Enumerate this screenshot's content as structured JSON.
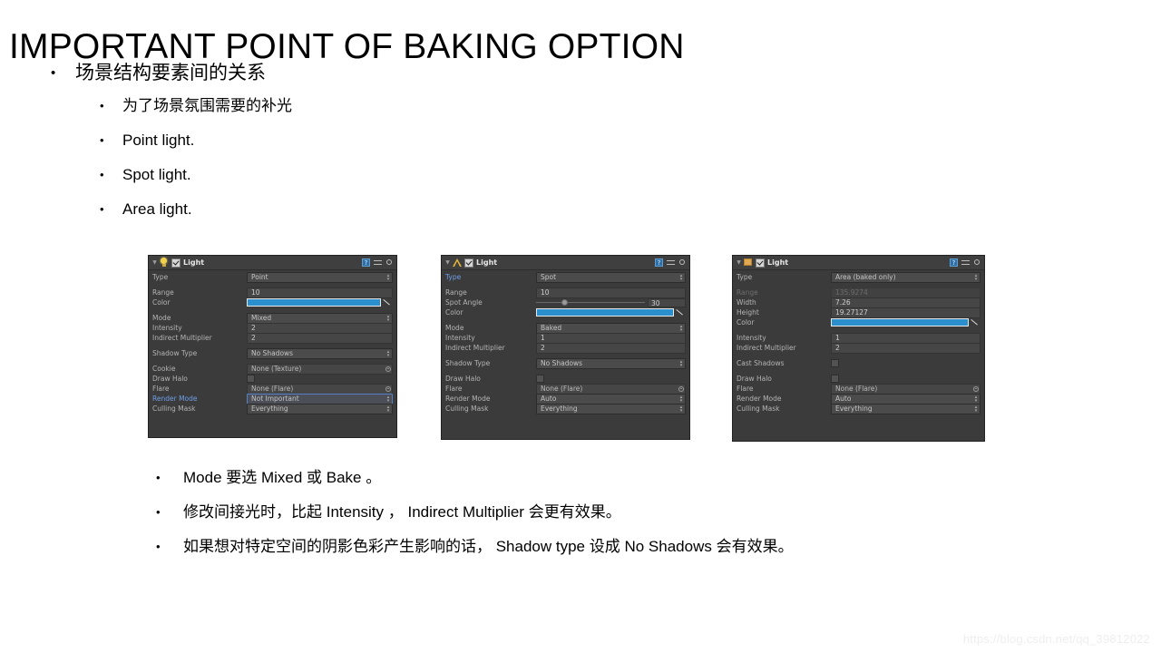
{
  "slide": {
    "title": "IMPORTANT POINT OF BAKING OPTION",
    "bullet_char": "•",
    "watermark": "https://blog.csdn.net/qq_39812022"
  },
  "top_bullets": [
    {
      "level": 1,
      "text": "场景结构要素间的关系"
    },
    {
      "level": 2,
      "text": "为了场景氛围需要的补光"
    },
    {
      "level": 2,
      "text": "Point light."
    },
    {
      "level": 2,
      "text": "Spot light."
    },
    {
      "level": 2,
      "text": "Area light."
    }
  ],
  "bottom_bullets": [
    {
      "text": "Mode 要选 Mixed 或 Bake 。"
    },
    {
      "text": "修改间接光时，比起 Intensity ，  Indirect Multiplier 会更有效果。"
    },
    {
      "text": "如果想对特定空间的阴影色彩产生影响的话，  Shadow type 设成 No Shadows 会有效果。"
    }
  ],
  "colors": {
    "light_color_swatch": "#2b8fce",
    "panel_background": "#3b3b3b",
    "highlight_label": "#6f9fe8",
    "bulb_icon": "#f2d24a",
    "cone_icon": "#e2b43c",
    "area_icon": "#e0a850"
  },
  "inspectors": [
    {
      "component_name": "Light",
      "icon": "point-light-bulb-icon",
      "enabled": true,
      "label_width": 104,
      "header_icons": [
        "help-icon",
        "preset-icon",
        "gear-icon"
      ],
      "rows": [
        {
          "kind": "popup",
          "label": "Type",
          "value": "Point"
        },
        {
          "kind": "spacer"
        },
        {
          "kind": "number",
          "label": "Range",
          "value": "10"
        },
        {
          "kind": "color",
          "label": "Color",
          "value": "#2b8fce"
        },
        {
          "kind": "spacer"
        },
        {
          "kind": "popup",
          "label": "Mode",
          "value": "Mixed"
        },
        {
          "kind": "number",
          "label": "Intensity",
          "value": "2"
        },
        {
          "kind": "number",
          "label": "Indirect Multiplier",
          "value": "2"
        },
        {
          "kind": "spacer"
        },
        {
          "kind": "popup",
          "label": "Shadow Type",
          "value": "No Shadows"
        },
        {
          "kind": "spacer"
        },
        {
          "kind": "object",
          "label": "Cookie",
          "value": "None (Texture)"
        },
        {
          "kind": "check",
          "label": "Draw Halo",
          "value": ""
        },
        {
          "kind": "object",
          "label": "Flare",
          "value": "None (Flare)"
        },
        {
          "kind": "popup",
          "label": "Render Mode",
          "value": "Not Important",
          "highlight": true
        },
        {
          "kind": "popup",
          "label": "Culling Mask",
          "value": "Everything"
        }
      ]
    },
    {
      "component_name": "Light",
      "icon": "spot-light-cone-icon",
      "enabled": true,
      "label_width": 100,
      "header_icons": [
        "help-icon",
        "preset-icon",
        "gear-icon"
      ],
      "rows": [
        {
          "kind": "popup",
          "label": "Type",
          "value": "Spot",
          "label_highlight": true
        },
        {
          "kind": "spacer"
        },
        {
          "kind": "number",
          "label": "Range",
          "value": "10"
        },
        {
          "kind": "slider",
          "label": "Spot Angle",
          "value": "30"
        },
        {
          "kind": "color",
          "label": "Color",
          "value": "#2b8fce"
        },
        {
          "kind": "spacer"
        },
        {
          "kind": "popup",
          "label": "Mode",
          "value": "Baked"
        },
        {
          "kind": "number",
          "label": "Intensity",
          "value": "1"
        },
        {
          "kind": "number",
          "label": "Indirect Multiplier",
          "value": "2"
        },
        {
          "kind": "spacer"
        },
        {
          "kind": "popup",
          "label": "Shadow Type",
          "value": "No Shadows"
        },
        {
          "kind": "spacer"
        },
        {
          "kind": "check",
          "label": "Draw Halo",
          "value": ""
        },
        {
          "kind": "object",
          "label": "Flare",
          "value": "None (Flare)"
        },
        {
          "kind": "popup",
          "label": "Render Mode",
          "value": "Auto"
        },
        {
          "kind": "popup",
          "label": "Culling Mask",
          "value": "Everything"
        }
      ]
    },
    {
      "component_name": "Light",
      "icon": "area-light-square-icon",
      "enabled": true,
      "label_width": 104,
      "header_icons": [
        "help-icon",
        "preset-icon",
        "gear-icon"
      ],
      "rows": [
        {
          "kind": "popup",
          "label": "Type",
          "value": "Area (baked only)"
        },
        {
          "kind": "spacer"
        },
        {
          "kind": "number",
          "label": "Range",
          "value": "135.9274",
          "disabled": true
        },
        {
          "kind": "number",
          "label": "Width",
          "value": "7.26"
        },
        {
          "kind": "number",
          "label": "Height",
          "value": "19.27127"
        },
        {
          "kind": "color",
          "label": "Color",
          "value": "#2b8fce"
        },
        {
          "kind": "spacer"
        },
        {
          "kind": "number",
          "label": "Intensity",
          "value": "1"
        },
        {
          "kind": "number",
          "label": "Indirect Multiplier",
          "value": "2"
        },
        {
          "kind": "spacer"
        },
        {
          "kind": "check",
          "label": "Cast Shadows",
          "value": ""
        },
        {
          "kind": "spacer"
        },
        {
          "kind": "check",
          "label": "Draw Halo",
          "value": ""
        },
        {
          "kind": "object",
          "label": "Flare",
          "value": "None (Flare)"
        },
        {
          "kind": "popup",
          "label": "Render Mode",
          "value": "Auto"
        },
        {
          "kind": "popup",
          "label": "Culling Mask",
          "value": "Everything"
        }
      ]
    }
  ]
}
